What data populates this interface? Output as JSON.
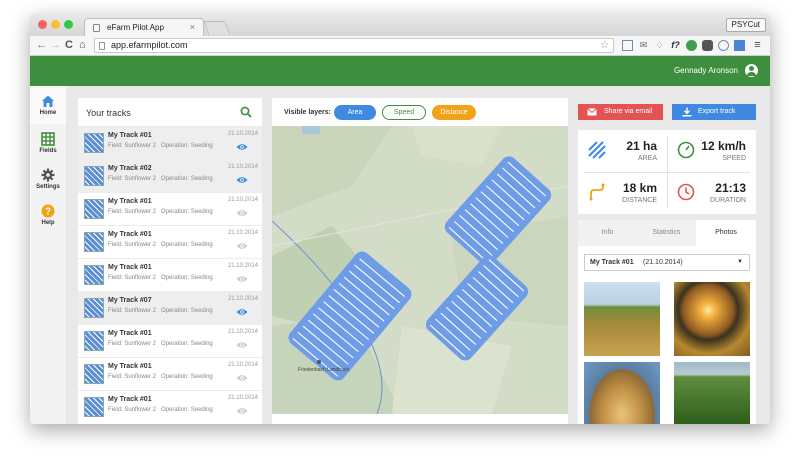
{
  "browser": {
    "tab_title": "eFarm Pilot App",
    "tab_close": "×",
    "url": "app.efarmpilot.com",
    "profile": "PSYCut"
  },
  "header": {
    "user_name": "Gennady Aronson"
  },
  "sidebar": {
    "items": [
      {
        "label": "Home",
        "icon": "home-icon",
        "active": true
      },
      {
        "label": "Fields",
        "icon": "grid-icon",
        "active": false
      },
      {
        "label": "Settings",
        "icon": "gear-icon",
        "active": false
      },
      {
        "label": "Help",
        "icon": "help-icon",
        "active": false
      }
    ]
  },
  "tracks": {
    "title": "Your tracks",
    "items": [
      {
        "name": "My Track #01",
        "field": "Field: Sunflower 2",
        "operation": "Operation: Seeding",
        "date": "21.10.2014",
        "visible": true,
        "selected": true
      },
      {
        "name": "My Track #02",
        "field": "Field: Sunflower 2",
        "operation": "Operation: Seeding",
        "date": "21.10.2014",
        "visible": true,
        "selected": true
      },
      {
        "name": "My Track #01",
        "field": "Field: Sunflower 2",
        "operation": "Operation: Seeding",
        "date": "21.10.2014",
        "visible": false,
        "selected": false
      },
      {
        "name": "My Track #01",
        "field": "Field: Sunflower 2",
        "operation": "Operation: Seeding",
        "date": "21.10.2014",
        "visible": false,
        "selected": false
      },
      {
        "name": "My Track #01",
        "field": "Field: Sunflower 2",
        "operation": "Operation: Seeding",
        "date": "21.10.2014",
        "visible": false,
        "selected": false
      },
      {
        "name": "My Track #07",
        "field": "Field: Sunflower 2",
        "operation": "Operation: Seeding",
        "date": "21.10.2014",
        "visible": true,
        "selected": true
      },
      {
        "name": "My Track #01",
        "field": "Field: Sunflower 2",
        "operation": "Operation: Seeding",
        "date": "21.10.2014",
        "visible": false,
        "selected": false
      },
      {
        "name": "My Track #01",
        "field": "Field: Sunflower 2",
        "operation": "Operation: Seeding",
        "date": "21.10.2014",
        "visible": false,
        "selected": false
      },
      {
        "name": "My Track #01",
        "field": "Field: Sunflower 2",
        "operation": "Operation: Seeding",
        "date": "21.10.2014",
        "visible": false,
        "selected": false
      }
    ]
  },
  "map": {
    "layers_label": "Visible layers:",
    "layers": [
      {
        "label": "Area",
        "active": true,
        "color": "#3f8ae0"
      },
      {
        "label": "Speed",
        "active": false,
        "color": "#3e8e3f"
      },
      {
        "label": "Distance",
        "active": true,
        "color": "#f0a318"
      }
    ],
    "place_label": "Friedenbach Landbach",
    "track_color": "#6f9ce6"
  },
  "actions": {
    "share": "Share via email",
    "export": "Export track"
  },
  "stats": {
    "area_value": "21 ha",
    "area_label": "AREA",
    "speed_value": "12 km/h",
    "speed_label": "SPEED",
    "distance_value": "18 km",
    "distance_label": "DISTANCE",
    "duration_value": "21:13",
    "duration_label": "DURATION"
  },
  "info": {
    "tabs": [
      "Info",
      "Statistics",
      "Photos"
    ],
    "active_tab": "Photos",
    "selected_track": "My Track #01",
    "selected_date": "(21.10.2014)"
  },
  "colors": {
    "brand_green": "#3e8e3f",
    "accent_blue": "#3f8ae0",
    "share_red": "#e45353",
    "warning_orange": "#f0a318"
  }
}
